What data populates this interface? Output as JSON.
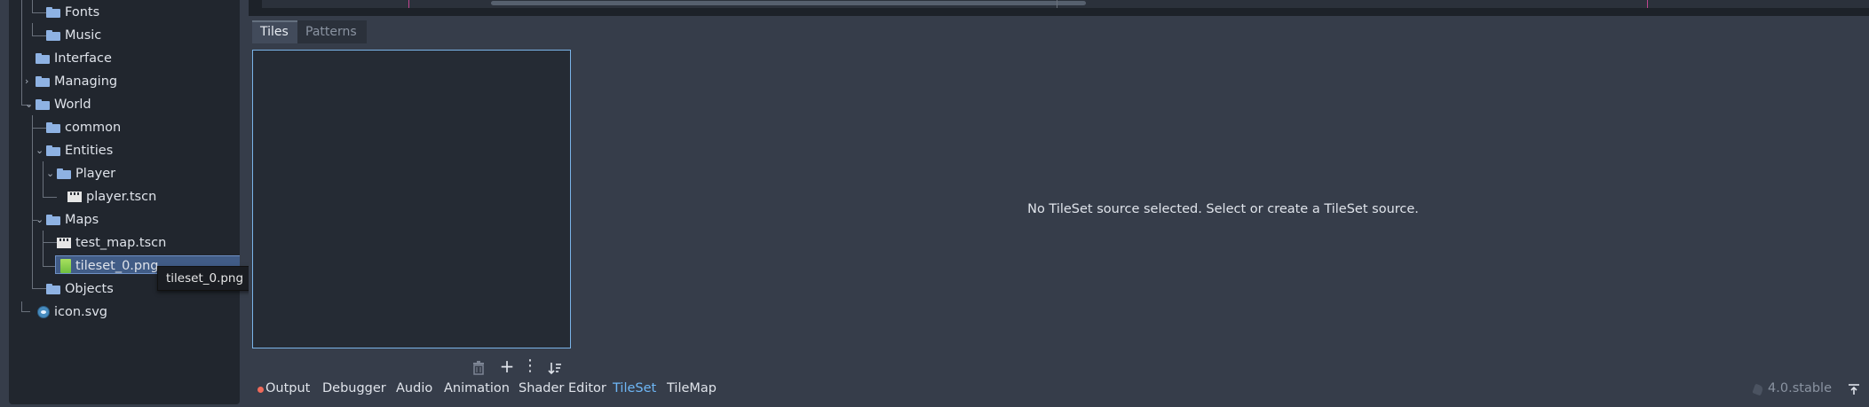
{
  "filesystem": {
    "items": [
      {
        "label": "Fonts",
        "type": "folder"
      },
      {
        "label": "Music",
        "type": "folder"
      },
      {
        "label": "Interface",
        "type": "folder"
      },
      {
        "label": "Managing",
        "type": "folder"
      },
      {
        "label": "World",
        "type": "folder"
      },
      {
        "label": "common",
        "type": "folder"
      },
      {
        "label": "Entities",
        "type": "folder"
      },
      {
        "label": "Player",
        "type": "folder"
      },
      {
        "label": "player.tscn",
        "type": "scene"
      },
      {
        "label": "Maps",
        "type": "folder"
      },
      {
        "label": "test_map.tscn",
        "type": "scene"
      },
      {
        "label": "tileset_0.png",
        "type": "image",
        "selected": true
      },
      {
        "label": "Objects",
        "type": "folder"
      },
      {
        "label": "icon.svg",
        "type": "svg"
      }
    ],
    "tooltip": "tileset_0.png"
  },
  "tileset_editor": {
    "tabs": [
      "Tiles",
      "Patterns"
    ],
    "active_tab": "Tiles",
    "empty_message": "No TileSet source selected. Select or create a TileSet source.",
    "toolbar_icons": [
      "trash-icon",
      "plus-icon",
      "kebab-menu-icon",
      "sort-icon"
    ]
  },
  "bottom_panel": {
    "tabs": [
      "Output",
      "Debugger",
      "Audio",
      "Animation",
      "Shader Editor",
      "TileSet",
      "TileMap"
    ],
    "active_tab": "TileSet",
    "version": "4.0.stable"
  },
  "colors": {
    "accent": "#6eb6f5",
    "folder": "#8eb2e3",
    "selection": "#415c86",
    "error_dot": "#f06a5a"
  }
}
